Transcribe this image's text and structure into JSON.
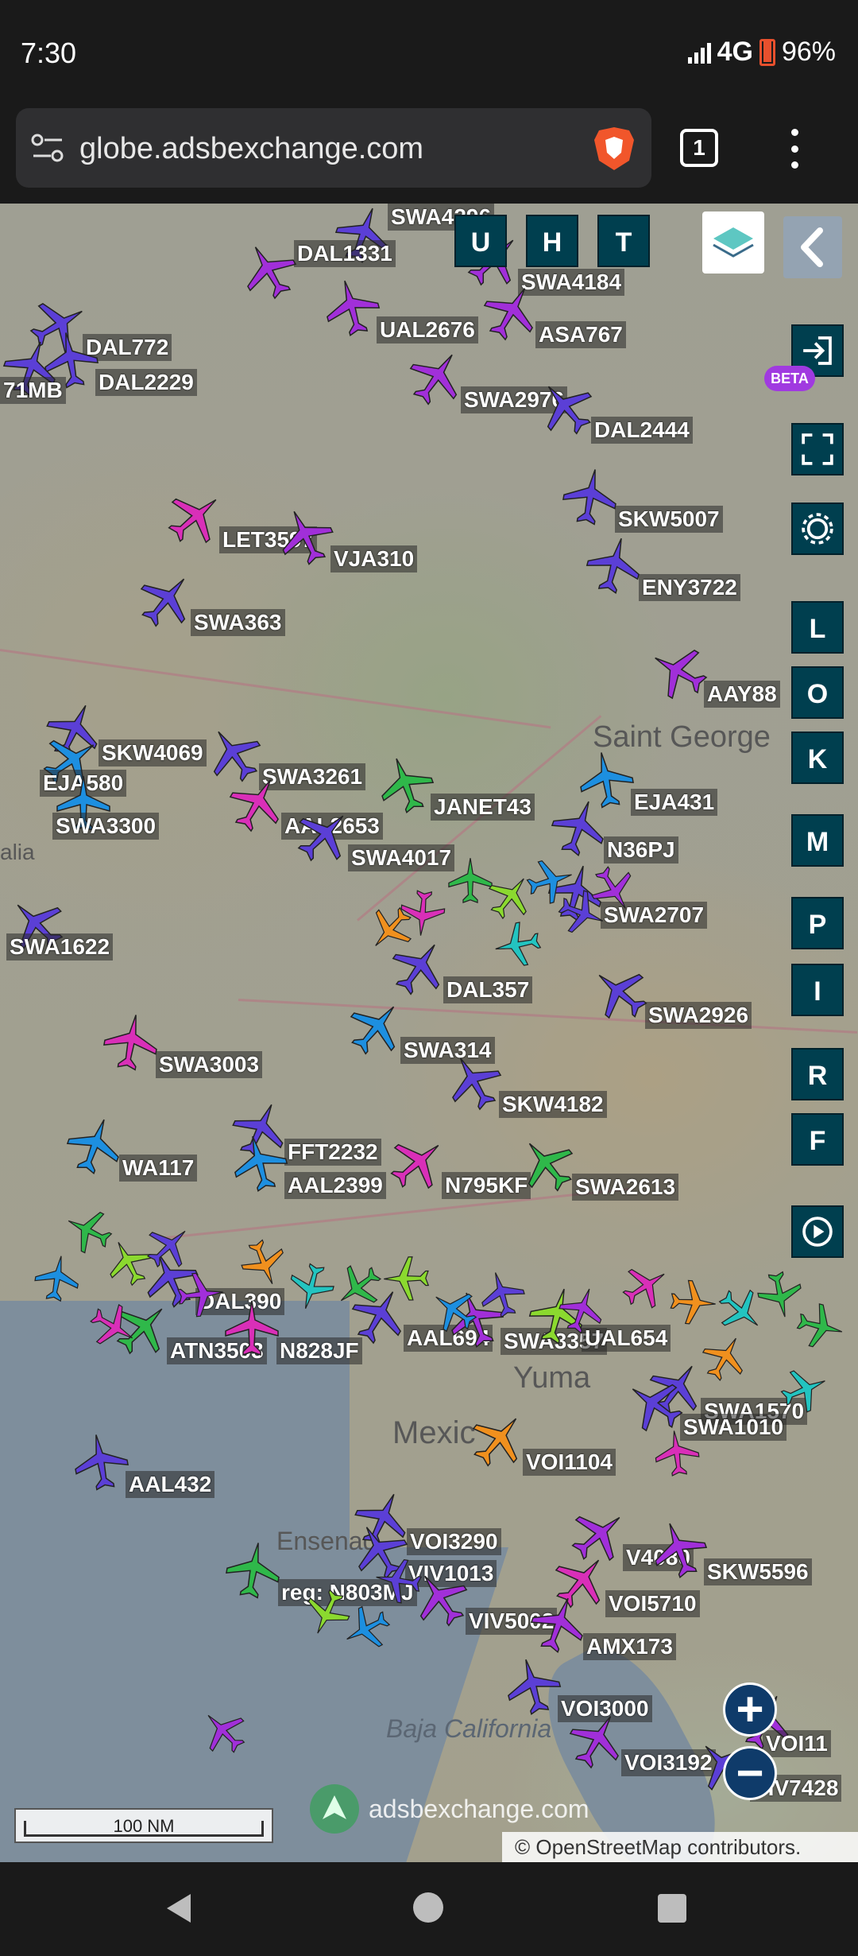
{
  "status": {
    "time": "7:30",
    "network": "4G",
    "battery": "96%"
  },
  "browser": {
    "url": "globe.adsbexchange.com",
    "tab_count": "1"
  },
  "map_controls": {
    "top_buttons": [
      "U",
      "H",
      "T"
    ],
    "side_buttons": [
      "L",
      "O",
      "K",
      "M",
      "P",
      "I",
      "R",
      "F"
    ],
    "beta": "BETA",
    "zoom_in": "+",
    "zoom_out": "−"
  },
  "places": {
    "saint_george": "Saint George",
    "yuma": "Yuma",
    "mexicali": "Mexic",
    "ensenada": "Ensenad",
    "baja": "Baja California",
    "alia": "alia"
  },
  "flights": [
    {
      "label": "SWA4296",
      "color": "#5b3fd6"
    },
    {
      "label": "DAL1331",
      "color": "#a12fd9"
    },
    {
      "label": "SWA4184",
      "color": "#a12fd9"
    },
    {
      "label": "UAL2676",
      "color": "#a12fd9"
    },
    {
      "label": "ASA767",
      "color": "#a12fd9"
    },
    {
      "label": "DAL772",
      "color": "#5b3fd6"
    },
    {
      "label": "DAL2229",
      "color": "#5b3fd6"
    },
    {
      "label": "71MB",
      "color": "#5b3fd6"
    },
    {
      "label": "SWA2976",
      "color": "#a12fd9"
    },
    {
      "label": "DAL2444",
      "color": "#5b3fd6"
    },
    {
      "label": "SKW5007",
      "color": "#5b3fd6"
    },
    {
      "label": "LET3597",
      "color": "#d92fb8"
    },
    {
      "label": "VJA310",
      "color": "#a12fd9"
    },
    {
      "label": "ENY3722",
      "color": "#5b3fd6"
    },
    {
      "label": "SWA363",
      "color": "#5b3fd6"
    },
    {
      "label": "AAY88",
      "color": "#a12fd9"
    },
    {
      "label": "SKW4069",
      "color": "#5b3fd6"
    },
    {
      "label": "SWA3261",
      "color": "#5b3fd6"
    },
    {
      "label": "EJA580",
      "color": "#1d8fe0"
    },
    {
      "label": "SWA3300",
      "color": "#1d8fe0"
    },
    {
      "label": "JANET43",
      "color": "#2fb84a"
    },
    {
      "label": "AAL2653",
      "color": "#d92fb8"
    },
    {
      "label": "SWA4017",
      "color": "#5b3fd6"
    },
    {
      "label": "EJA431",
      "color": "#1d8fe0"
    },
    {
      "label": "N36PJ",
      "color": "#5b3fd6"
    },
    {
      "label": "SWA1622",
      "color": "#5b3fd6"
    },
    {
      "label": "SWA2707",
      "color": "#5b3fd6"
    },
    {
      "label": "DAL357",
      "color": "#5b3fd6"
    },
    {
      "label": "SWA2926",
      "color": "#5b3fd6"
    },
    {
      "label": "SWA3003",
      "color": "#d92fb8"
    },
    {
      "label": "SWA314",
      "color": "#1d8fe0"
    },
    {
      "label": "SKW4182",
      "color": "#5b3fd6"
    },
    {
      "label": "FFT2232",
      "color": "#5b3fd6"
    },
    {
      "label": "AAL2399",
      "color": "#1d8fe0"
    },
    {
      "label": "N795KF",
      "color": "#d92fb8"
    },
    {
      "label": "SWA2613",
      "color": "#2fb84a"
    },
    {
      "label": "WA117",
      "color": "#1d8fe0"
    },
    {
      "label": "DAL390",
      "color": "#5b3fd6"
    },
    {
      "label": "ATN3503",
      "color": "#2fb84a"
    },
    {
      "label": "N828JF",
      "color": "#d92fb8"
    },
    {
      "label": "AAL694",
      "color": "#5b3fd6"
    },
    {
      "label": "SWA3357",
      "color": "#a12fd9"
    },
    {
      "label": "UAL654",
      "color": "#8bd92f"
    },
    {
      "label": "SWA1570",
      "color": "#5b3fd6"
    },
    {
      "label": "SWA1010",
      "color": "#5b3fd6"
    },
    {
      "label": "VOI1104",
      "color": "#f0901e"
    },
    {
      "label": "AAL432",
      "color": "#5b3fd6"
    },
    {
      "label": "VOI3290",
      "color": "#5b3fd6"
    },
    {
      "label": "VIV1013",
      "color": "#5b3fd6"
    },
    {
      "label": "V4080",
      "color": "#a12fd9"
    },
    {
      "label": "SKW5596",
      "color": "#a12fd9"
    },
    {
      "label": "reg: N803MJ",
      "color": "#2fb84a"
    },
    {
      "label": "VOI5710",
      "color": "#d92fb8"
    },
    {
      "label": "VIV5002",
      "color": "#a12fd9"
    },
    {
      "label": "AMX173",
      "color": "#a12fd9"
    },
    {
      "label": "VOI3000",
      "color": "#5b3fd6"
    },
    {
      "label": "VOI3192",
      "color": "#a12fd9"
    },
    {
      "label": "VIV7428",
      "color": "#5b3fd6"
    },
    {
      "label": "VOI11",
      "color": "#a12fd9"
    }
  ],
  "scale": "100 NM",
  "watermark": "adsbexchange.com",
  "attribution": "© OpenStreetMap contributors."
}
